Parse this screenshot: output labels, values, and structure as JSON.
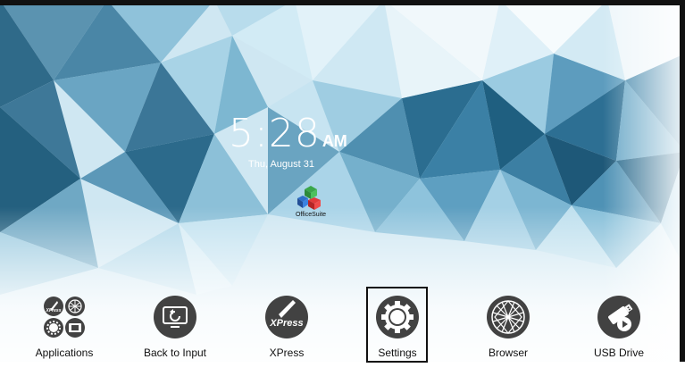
{
  "clock": {
    "time": "5:28",
    "ampm": "AM",
    "date": "Thu, August 31"
  },
  "widget": {
    "label": "OfficeSuite",
    "icon": "officesuite-icon"
  },
  "dock": {
    "selected": "Settings",
    "items": [
      {
        "label": "Applications",
        "icon": "applications-grid-icon"
      },
      {
        "label": "Back to Input",
        "icon": "back-to-input-icon"
      },
      {
        "label": "XPress",
        "icon": "xpress-icon"
      },
      {
        "label": "Settings",
        "icon": "gear-icon"
      },
      {
        "label": "Browser",
        "icon": "globe-icon"
      },
      {
        "label": "USB Drive",
        "icon": "usb-drive-icon"
      }
    ]
  },
  "colors": {
    "dock_icon": "#424242",
    "wallpaper_light": "#d7eef7",
    "wallpaper_dark": "#2f6f8f"
  }
}
